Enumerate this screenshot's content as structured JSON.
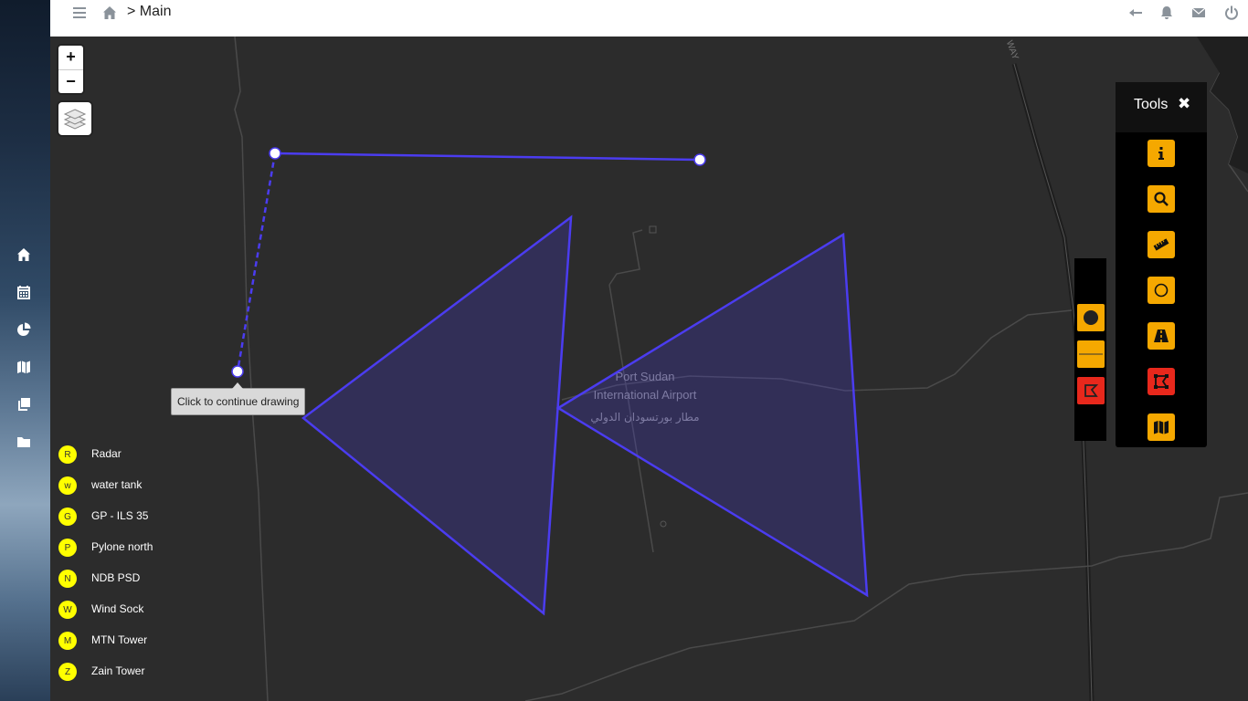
{
  "topbar": {
    "breadcrumb": "> Main",
    "icons": [
      "menu-icon",
      "home-icon",
      "back-arrow-icon",
      "bell-icon",
      "envelope-icon",
      "power-icon"
    ]
  },
  "sidebar": {
    "items": [
      {
        "icon": "home-icon"
      },
      {
        "icon": "calendar-icon"
      },
      {
        "icon": "pie-chart-icon"
      },
      {
        "icon": "map-icon"
      },
      {
        "icon": "copy-icon"
      },
      {
        "icon": "folder-icon"
      }
    ]
  },
  "map": {
    "zoom_in": "+",
    "zoom_out": "−",
    "tooltip": "Click to continue drawing",
    "airport_label_en_1": "Port Sudan",
    "airport_label_en_2": "International Airport",
    "airport_label_ar": "مطار بورتسودان الدولي",
    "road_label": "WAY",
    "draw_color": "#4b3cf0"
  },
  "legend": [
    {
      "badge": "R",
      "label": "Radar"
    },
    {
      "badge": "w",
      "label": "water tank"
    },
    {
      "badge": "G",
      "label": "GP - ILS 35"
    },
    {
      "badge": "P",
      "label": "Pylone north"
    },
    {
      "badge": "N",
      "label": "NDB PSD"
    },
    {
      "badge": "W",
      "label": "Wind Sock"
    },
    {
      "badge": "M",
      "label": "MTN Tower"
    },
    {
      "badge": "Z",
      "label": "Zain Tower"
    }
  ],
  "draw_toolbar": [
    {
      "icon": "circle-marker-icon",
      "color": "#f5a800"
    },
    {
      "icon": "polyline-icon",
      "color": "#f5a800"
    },
    {
      "icon": "polygon-icon",
      "color": "#e8281c"
    }
  ],
  "tools": {
    "title": "Tools",
    "close": "✖",
    "buttons": [
      {
        "icon": "info-icon",
        "color": "#f5a800"
      },
      {
        "icon": "search-icon",
        "color": "#f5a800"
      },
      {
        "icon": "ruler-icon",
        "color": "#f5a800"
      },
      {
        "icon": "circle-icon",
        "color": "#f5a800"
      },
      {
        "icon": "road-icon",
        "color": "#f5a800"
      },
      {
        "icon": "draw-polygon-icon",
        "color": "#e8281c"
      },
      {
        "icon": "map-icon",
        "color": "#f5a800"
      }
    ]
  }
}
